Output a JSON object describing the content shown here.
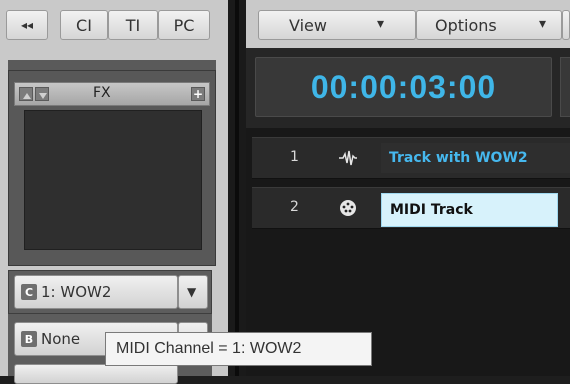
{
  "left_panel": {
    "back_glyph": "◂◂",
    "tabs": [
      "CI",
      "TI",
      "PC"
    ],
    "fx": {
      "label": "FX",
      "add_glyph": "+"
    },
    "input_dropdown": {
      "badge": "C",
      "value": "1: WOW2",
      "arrow": "▼"
    },
    "output_dropdown": {
      "badge": "B",
      "value": "None"
    }
  },
  "menubar": {
    "view_label": "View",
    "options_label": "Options",
    "arrow": "▾"
  },
  "transport": {
    "time": "00:00:03:00"
  },
  "tracks": [
    {
      "number": "1",
      "icon": "waveform-icon",
      "name": "Track with WOW2",
      "selected": false
    },
    {
      "number": "2",
      "icon": "midi-icon",
      "name": "MIDI Track",
      "selected": true
    }
  ],
  "tooltip": {
    "text": "MIDI Channel = 1: WOW2"
  },
  "colors": {
    "time": "#3fb6e8",
    "track_name": "#46b8ee",
    "selected_name_bg": "#d7f2fb"
  }
}
